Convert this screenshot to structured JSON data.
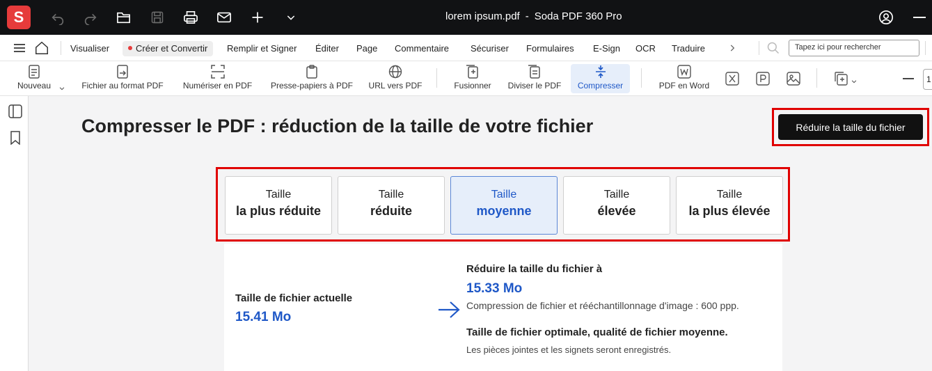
{
  "colors": {
    "brand": "#e63b3b",
    "accent": "#1f58c7",
    "highlight": "#e00000",
    "titlebar": "#111214"
  },
  "titlebar": {
    "logo": "S",
    "document": "lorem ipsum.pdf",
    "separator": "-",
    "app": "Soda PDF 360 Pro"
  },
  "menubar": {
    "items": [
      "Visualiser",
      "Créer et Convertir",
      "Remplir et Signer",
      "Éditer",
      "Page",
      "Commentaire",
      "Sécuriser",
      "Formulaires",
      "E-Sign",
      "OCR",
      "Traduire"
    ],
    "active_item": "Créer et Convertir",
    "search_placeholder": "Tapez ici pour rechercher"
  },
  "toolbar": {
    "tools": [
      "Nouveau",
      "Fichier au format PDF",
      "Numériser en PDF",
      "Presse-papiers à PDF",
      "URL vers PDF",
      "Fusionner",
      "Diviser le PDF",
      "Compresser",
      "PDF en Word"
    ],
    "active_tool": "Compresser",
    "zoom_partial": "1"
  },
  "main": {
    "title": "Compresser le PDF : réduction de la taille de votre fichier",
    "reduce_button": "Réduire la taille du fichier",
    "levels": [
      {
        "line1": "Taille",
        "line2": "la plus réduite"
      },
      {
        "line1": "Taille",
        "line2": "réduite"
      },
      {
        "line1": "Taille",
        "line2": "moyenne"
      },
      {
        "line1": "Taille",
        "line2": "élevée"
      },
      {
        "line1": "Taille",
        "line2": "la plus élevée"
      }
    ],
    "selected_level": "moyenne",
    "current_label": "Taille de fichier actuelle",
    "current_value": "15.41 Mo",
    "reduce_label": "Réduire la taille du fichier à",
    "reduce_value": "15.33 Mo",
    "reduce_desc": "Compression de fichier et rééchantillonnage d'image : 600 ppp.",
    "optimal_label": "Taille de fichier optimale, qualité de fichier moyenne.",
    "optimal_desc": "Les pièces jointes et les signets seront enregistrés."
  }
}
